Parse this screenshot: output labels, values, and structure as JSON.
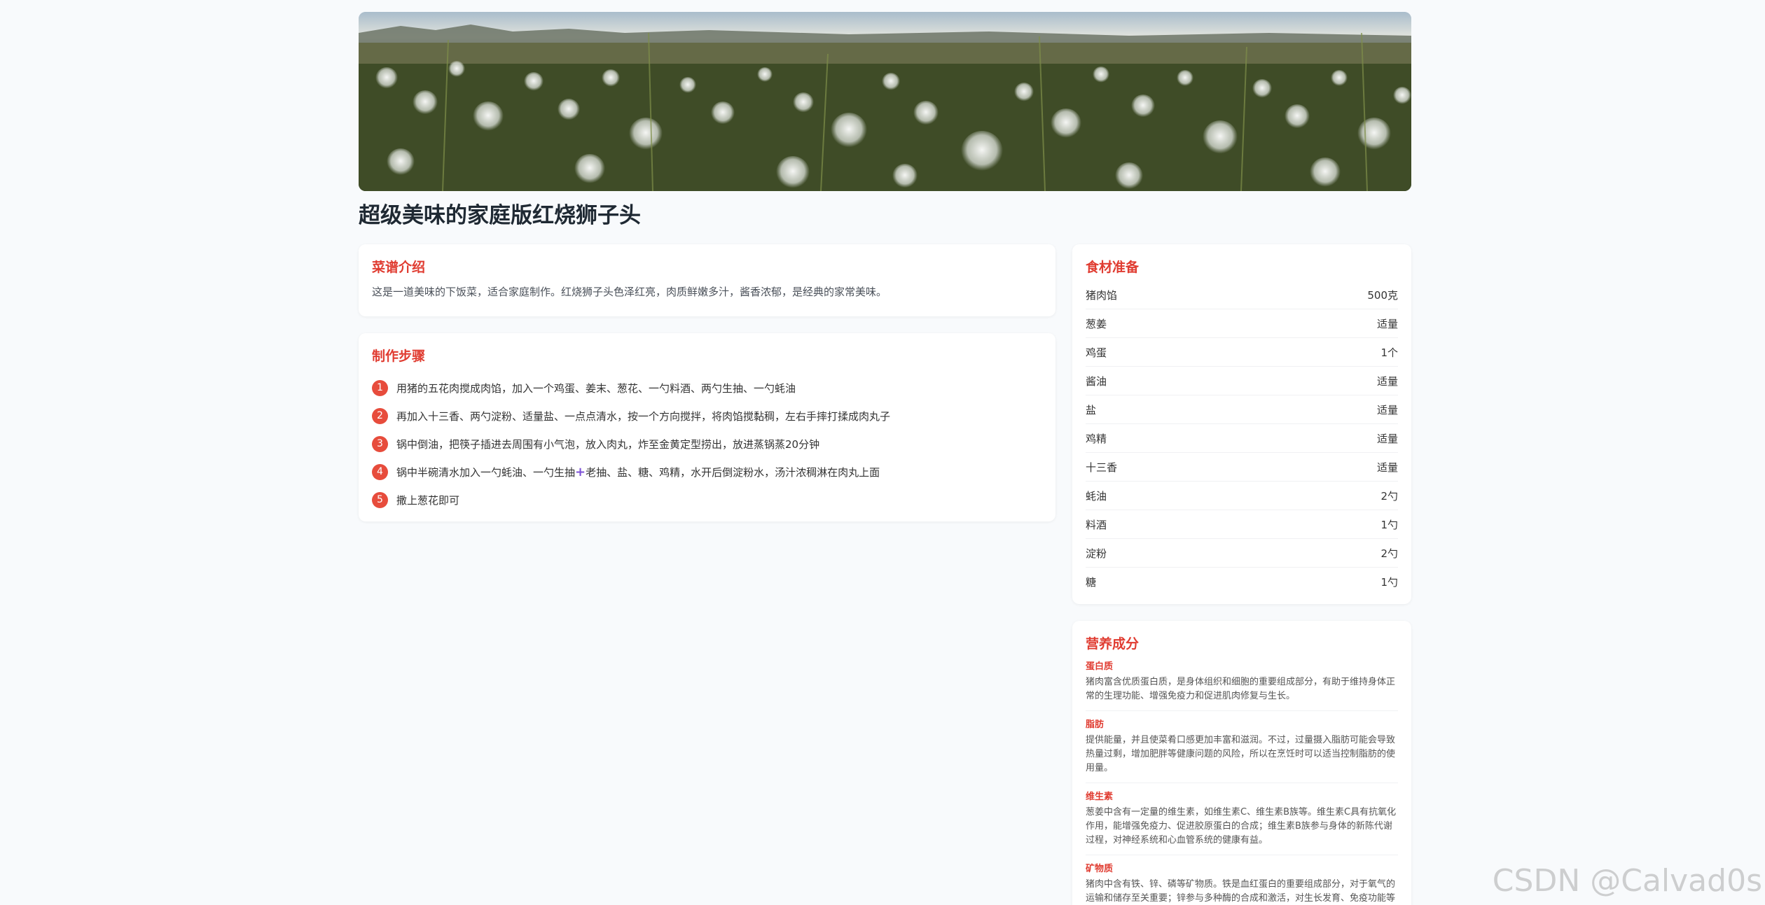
{
  "hero": {
    "alt": "dandelion field"
  },
  "recipe": {
    "title": "超级美味的家庭版红烧狮子头"
  },
  "intro": {
    "heading": "菜谱介绍",
    "text": "这是一道美味的下饭菜，适合家庭制作。红烧狮子头色泽红亮，肉质鲜嫩多汁，酱香浓郁，是经典的家常美味。"
  },
  "steps": {
    "heading": "制作步骤",
    "items": [
      {
        "num": "1",
        "text": "用猪的五花肉搅成肉馅，加入一个鸡蛋、姜末、葱花、一勺料酒、两勺生抽、一勺蚝油"
      },
      {
        "num": "2",
        "text": "再加入十三香、两勺淀粉、适量盐、一点点清水，按一个方向搅拌，将肉馅搅黏稠，左右手摔打揉成肉丸子"
      },
      {
        "num": "3",
        "text": "锅中倒油，把筷子插进去周围有小气泡，放入肉丸，炸至金黄定型捞出，放进蒸锅蒸20分钟"
      },
      {
        "num": "4",
        "text_a": "锅中半碗清水加入一勺蚝油、一勺生抽",
        "plus": "+",
        "text_b": "老抽、盐、糖、鸡精，水开后倒淀粉水，汤汁浓稠淋在肉丸上面"
      },
      {
        "num": "5",
        "text": "撒上葱花即可"
      }
    ]
  },
  "ingredients": {
    "heading": "食材准备",
    "items": [
      {
        "name": "猪肉馅",
        "amount": "500克"
      },
      {
        "name": "葱姜",
        "amount": "适量"
      },
      {
        "name": "鸡蛋",
        "amount": "1个"
      },
      {
        "name": "酱油",
        "amount": "适量"
      },
      {
        "name": "盐",
        "amount": "适量"
      },
      {
        "name": "鸡精",
        "amount": "适量"
      },
      {
        "name": "十三香",
        "amount": "适量"
      },
      {
        "name": "蚝油",
        "amount": "2勺"
      },
      {
        "name": "料酒",
        "amount": "1勺"
      },
      {
        "name": "淀粉",
        "amount": "2勺"
      },
      {
        "name": "糖",
        "amount": "1勺"
      }
    ]
  },
  "nutrition": {
    "heading": "营养成分",
    "items": [
      {
        "name": "蛋白质",
        "desc": "猪肉富含优质蛋白质，是身体组织和细胞的重要组成部分，有助于维持身体正常的生理功能、增强免疫力和促进肌肉修复与生长。"
      },
      {
        "name": "脂肪",
        "desc": "提供能量，并且使菜肴口感更加丰富和滋润。不过，过量摄入脂肪可能会导致热量过剩，增加肥胖等健康问题的风险，所以在烹饪时可以适当控制脂肪的使用量。"
      },
      {
        "name": "维生素",
        "desc": "葱姜中含有一定量的维生素，如维生素C、维生素B族等。维生素C具有抗氧化作用，能增强免疫力、促进胶原蛋白的合成；维生素B族参与身体的新陈代谢过程，对神经系统和心血管系统的健康有益。"
      },
      {
        "name": "矿物质",
        "desc": "猪肉中含有铁、锌、磷等矿物质。铁是血红蛋白的重要组成部分，对于氧气的运输和储存至关重要；锌参与多种酶的合成和激活，对生长发育、免疫功能等有重要作用。"
      }
    ]
  },
  "watermark": {
    "text": "CSDN @Calvad0s"
  }
}
